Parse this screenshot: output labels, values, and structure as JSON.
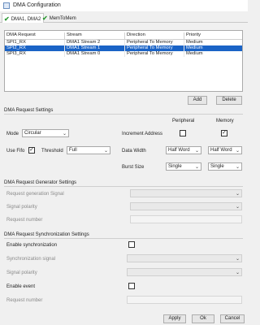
{
  "window": {
    "title": "DMA Configuration"
  },
  "tabs": [
    {
      "label": "DMA1, DMA2",
      "active": true
    },
    {
      "label": "MemToMem",
      "active": false
    }
  ],
  "table": {
    "headers": [
      "DMA Request",
      "Stream",
      "Direction",
      "Priority"
    ],
    "rows": [
      [
        "SPI1_RX",
        "DMA1 Stream 2",
        "Peripheral To Memory",
        "Medium"
      ],
      [
        "SPI2_RX",
        "DMA1 Stream 1",
        "Peripheral To Memory",
        "Medium"
      ],
      [
        "SPI3_RX",
        "DMA1 Stream 0",
        "Peripheral To Memory",
        "Medium"
      ]
    ],
    "selected_row": 1
  },
  "actions": {
    "add": "Add",
    "delete": "Delete"
  },
  "settings": {
    "section": "DMA Request Settings",
    "col_peripheral": "Peripheral",
    "col_memory": "Memory",
    "mode_label": "Mode",
    "mode_value": "Circular",
    "increment_label": "Increment Address",
    "use_fifo_label": "Use Fifo",
    "threshold_label": "Threshold",
    "threshold_value": "Full",
    "data_width_label": "Data Width",
    "data_width_peripheral": "Half Word",
    "data_width_memory": "Half Word",
    "burst_size_label": "Burst Size",
    "burst_peripheral": "Single",
    "burst_memory": "Single"
  },
  "generator": {
    "section": "DMA Request Generator Settings",
    "signal_label": "Request generation Signal",
    "polarity_label": "Signal polarity",
    "number_label": "Request number"
  },
  "sync": {
    "section": "DMA Request Synchronization Settings",
    "enable_label": "Enable synchronization",
    "signal_label": "Synchronization signal",
    "polarity_label": "Signal polarity",
    "event_label": "Enable event",
    "number_label": "Request number"
  },
  "footer": {
    "apply": "Apply",
    "ok": "Ok",
    "cancel": "Cancel"
  }
}
